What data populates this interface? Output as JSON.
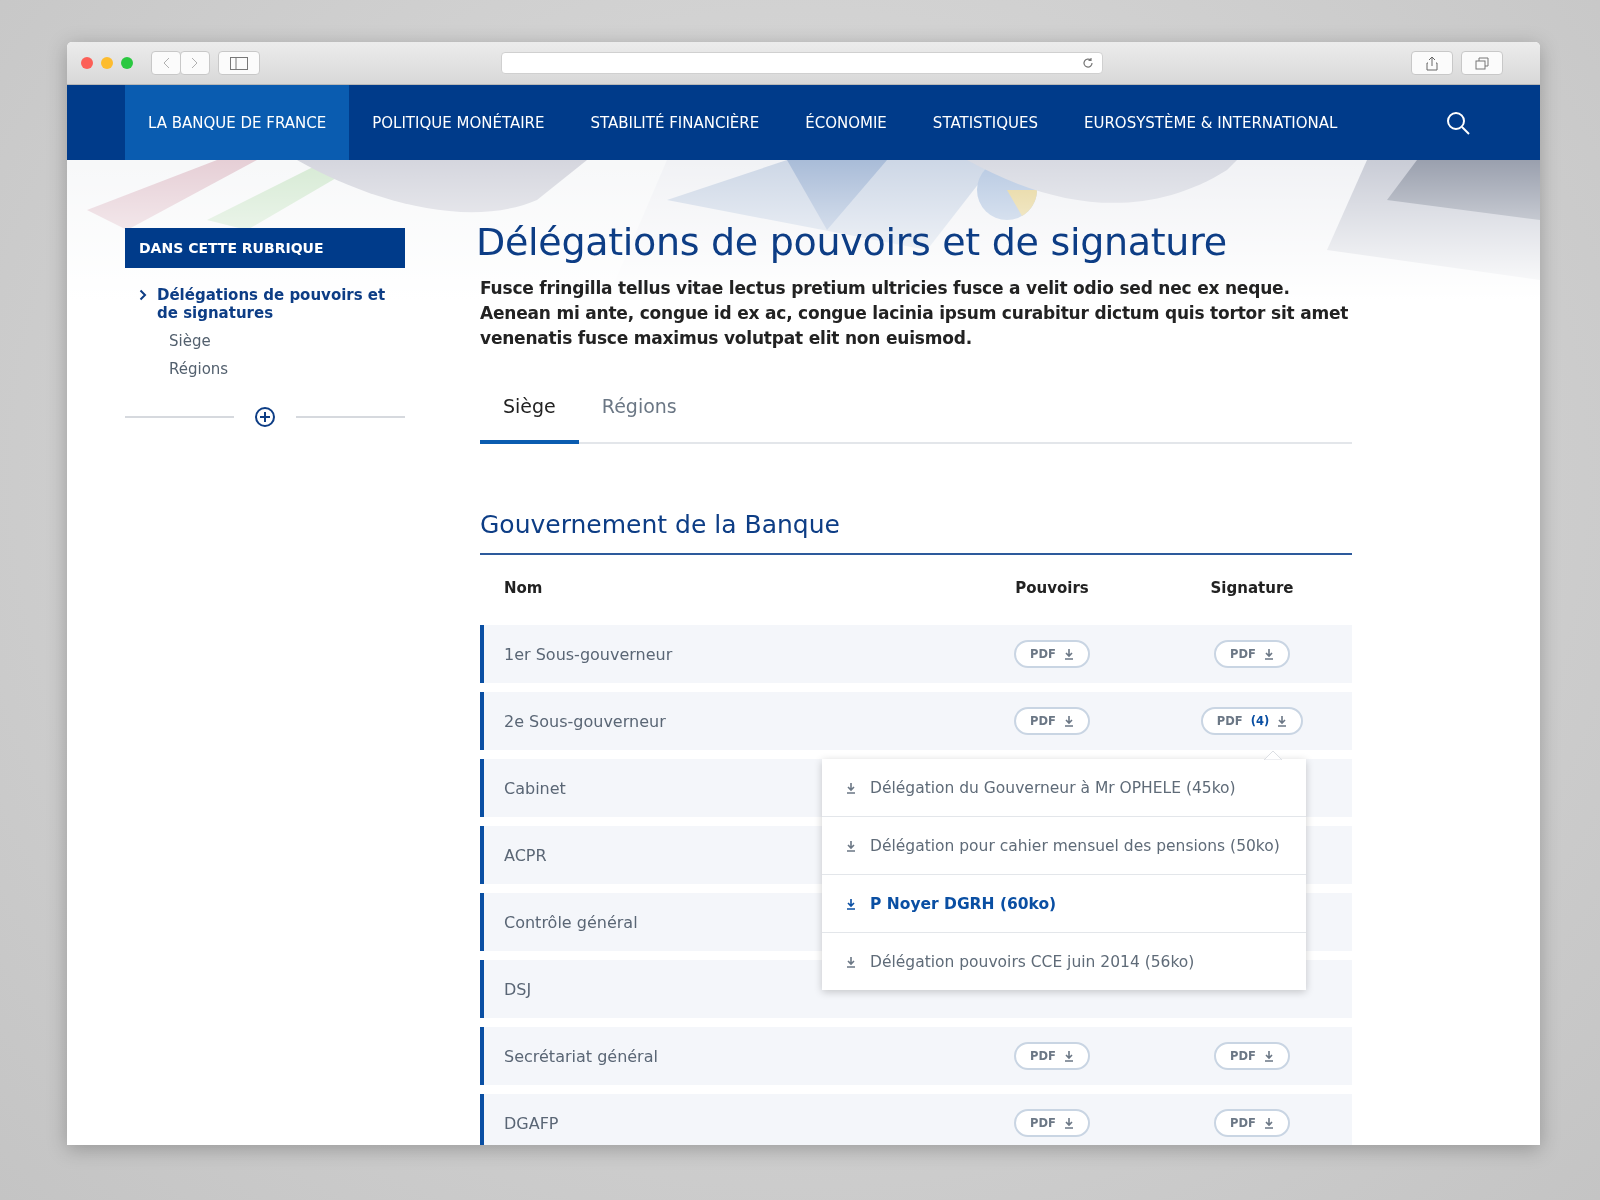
{
  "nav": {
    "items": [
      {
        "label": "LA BANQUE DE FRANCE",
        "selected": true
      },
      {
        "label": "POLITIQUE MONÉTAIRE",
        "selected": false
      },
      {
        "label": "STABILITÉ FINANCIÈRE",
        "selected": false
      },
      {
        "label": "ÉCONOMIE",
        "selected": false
      },
      {
        "label": "STATISTIQUES",
        "selected": false
      },
      {
        "label": "EUROSYSTÈME & INTERNATIONAL",
        "selected": false
      }
    ]
  },
  "sidebar": {
    "heading": "DANS CETTE RUBRIQUE",
    "items": [
      {
        "label": "Délégations de pouvoirs et de signatures",
        "selected": true,
        "children": [
          {
            "label": "Siège",
            "selected": false
          },
          {
            "label": "Régions",
            "selected": false
          }
        ]
      }
    ]
  },
  "title": "Délégations de pouvoirs et de signature",
  "intro": "Fusce fringilla tellus vitae lectus pretium ultricies fusce a velit odio sed nec ex neque. Aenean mi ante, congue id ex ac, congue lacinia ipsum curabitur dictum quis tortor sit amet venenatis fusce maximus volutpat elit non euismod.",
  "tabs": [
    {
      "label": "Siège",
      "selected": true
    },
    {
      "label": "Régions",
      "selected": false
    }
  ],
  "section": {
    "heading": "Gouvernement de la Banque",
    "table": {
      "columns": [
        "Nom",
        "Pouvoirs",
        "Signature"
      ],
      "rows": [
        {
          "name": "1er Sous-gouverneur",
          "pouvoirs": {
            "label": "PDF"
          },
          "signature": {
            "label": "PDF"
          }
        },
        {
          "name": "2e Sous-gouverneur",
          "pouvoirs": {
            "label": "PDF"
          },
          "signature": {
            "label": "PDF",
            "count": "(4)",
            "expanded": true,
            "menu": [
              {
                "label": "Délégation du Gouverneur à Mr OPHELE (45ko)",
                "selected": false
              },
              {
                "label": "Délégation pour cahier mensuel des pensions (50ko)",
                "selected": false
              },
              {
                "label": "P Noyer DGRH (60ko)",
                "selected": true
              },
              {
                "label": "Délégation pouvoirs CCE juin 2014 (56ko)",
                "selected": false
              }
            ]
          }
        },
        {
          "name": "Cabinet"
        },
        {
          "name": "ACPR"
        },
        {
          "name": "Contrôle général"
        },
        {
          "name": "DSJ"
        },
        {
          "name": "Secrétariat général",
          "pouvoirs": {
            "label": "PDF"
          },
          "signature": {
            "label": "PDF"
          }
        },
        {
          "name": "DGAFP",
          "pouvoirs": {
            "label": "PDF"
          },
          "signature": {
            "label": "PDF"
          }
        }
      ]
    }
  }
}
